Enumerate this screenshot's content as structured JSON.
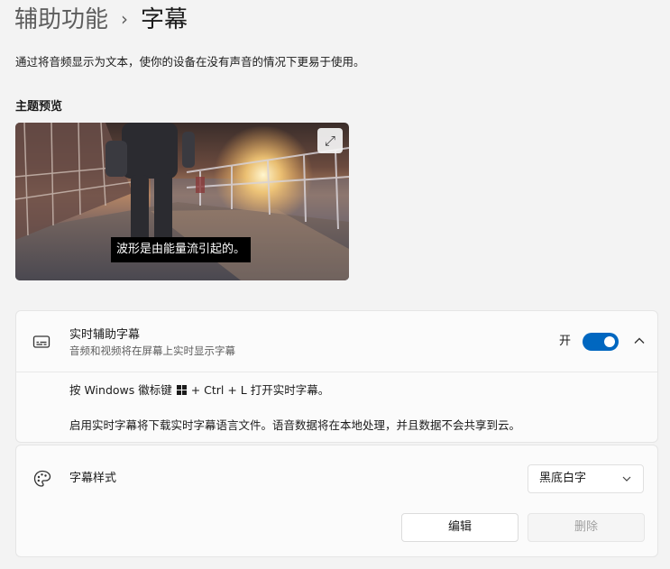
{
  "header": {
    "breadcrumb_parent": "辅助功能",
    "breadcrumb_separator": "›",
    "breadcrumb_current": "字幕"
  },
  "description": "通过将音频显示为文本，使你的设备在没有声音的情况下更易于使用。",
  "preview": {
    "section_title": "主题预览",
    "caption_sample": "波形是由能量流引起的。",
    "expand_icon_glyph": "⤢"
  },
  "live_captions": {
    "title": "实时辅助字幕",
    "subtitle": "音频和视频将在屏幕上实时显示字幕",
    "toggle_state_label": "开",
    "toggle_on": true,
    "shortcut_before": "按 Windows 徽标键 ",
    "shortcut_after": " + Ctrl + L 打开实时字幕。",
    "download_note": "启用实时字幕将下载实时字幕语言文件。语音数据将在本地处理，并且数据不会共享到云。"
  },
  "caption_style": {
    "title": "字幕样式",
    "selected": "黑底白字",
    "edit_button": "编辑",
    "delete_button": "删除"
  },
  "colors": {
    "accent": "#0067c0",
    "background": "#f3f3f3",
    "card": "#fbfbfb"
  },
  "icons": {
    "live_captions": "captions-icon",
    "caption_style": "palette-icon",
    "expand": "expand-icon",
    "collapse": "chevron-up-icon",
    "dropdown": "chevron-down-icon",
    "windows": "windows-logo-icon"
  }
}
